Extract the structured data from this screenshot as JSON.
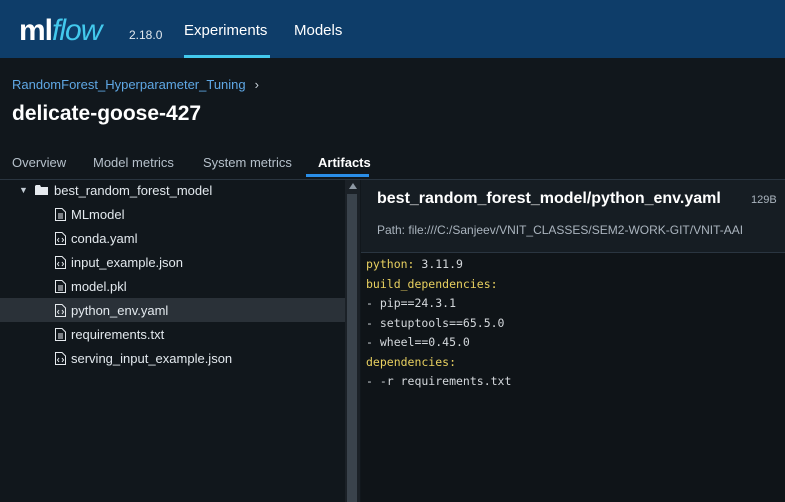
{
  "header": {
    "logo_ml": "ml",
    "logo_flow": "flow",
    "version": "2.18.0",
    "nav": [
      {
        "label": "Experiments",
        "active": true
      },
      {
        "label": "Models",
        "active": false
      }
    ]
  },
  "breadcrumb": {
    "experiment": "RandomForest_Hyperparameter_Tuning",
    "separator": "›"
  },
  "page_title": "delicate-goose-427",
  "tabs": [
    {
      "label": "Overview",
      "active": false
    },
    {
      "label": "Model metrics",
      "active": false
    },
    {
      "label": "System metrics",
      "active": false
    },
    {
      "label": "Artifacts",
      "active": true
    }
  ],
  "artifact_tree": {
    "folder": "best_random_forest_model",
    "files": [
      {
        "name": "MLmodel",
        "selected": false
      },
      {
        "name": "conda.yaml",
        "selected": false
      },
      {
        "name": "input_example.json",
        "selected": false
      },
      {
        "name": "model.pkl",
        "selected": false
      },
      {
        "name": "python_env.yaml",
        "selected": true
      },
      {
        "name": "requirements.txt",
        "selected": false
      },
      {
        "name": "serving_input_example.json",
        "selected": false
      }
    ]
  },
  "viewer": {
    "title": "best_random_forest_model/python_env.yaml",
    "size": "129B",
    "path": "Path: file:///C:/Sanjeev/VNIT_CLASSES/SEM2-WORK-GIT/VNIT-AAI",
    "lines": [
      {
        "key": "python:",
        "value": " 3.11.9"
      },
      {
        "key": "build_dependencies:",
        "value": ""
      },
      {
        "key": "",
        "value": "- pip==24.3.1"
      },
      {
        "key": "",
        "value": "- setuptools==65.5.0"
      },
      {
        "key": "",
        "value": "- wheel==0.45.0"
      },
      {
        "key": "dependencies:",
        "value": ""
      },
      {
        "key": "",
        "value": "- -r requirements.txt"
      }
    ]
  },
  "colors": {
    "header_bg": "#0e3d69",
    "accent": "#43c9ed",
    "tab_accent": "#2a8ee8",
    "yaml_key": "#e8d060"
  }
}
